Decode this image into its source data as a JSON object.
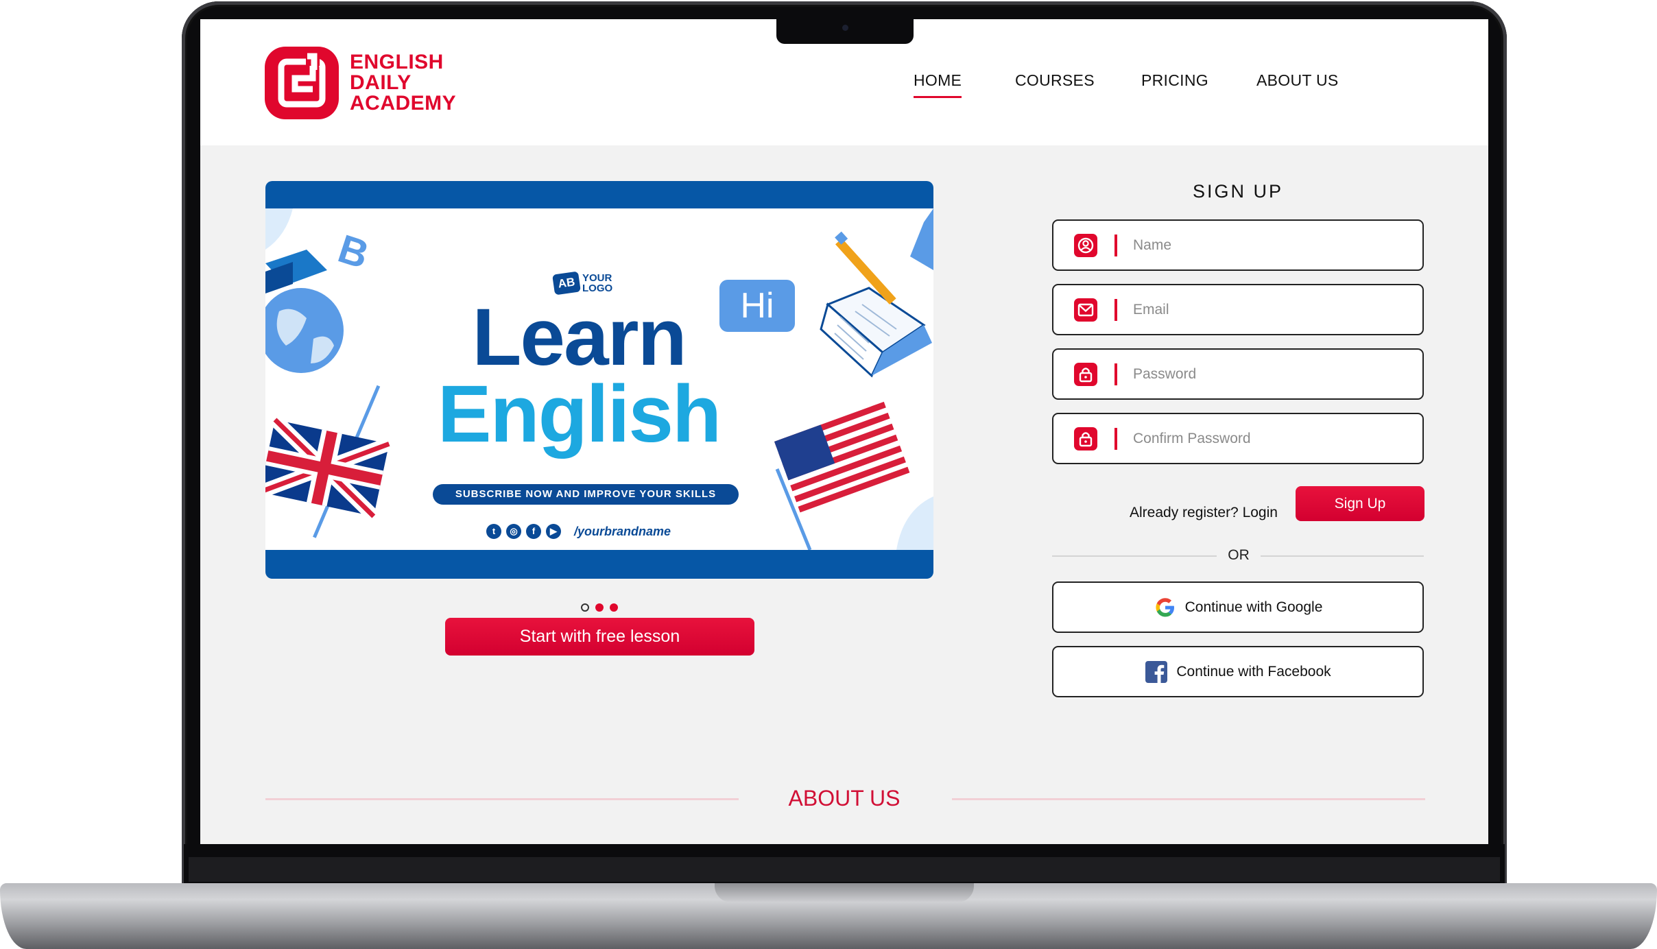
{
  "brand": {
    "logo_icon": "ed-monogram-logo",
    "name_lines": [
      "ENGLISH",
      "DAILY",
      "ACADEMY"
    ],
    "accent_color": "#e0072d"
  },
  "nav": {
    "items": [
      {
        "label": "HOME",
        "active": true
      },
      {
        "label": "COURSES",
        "active": false
      },
      {
        "label": "PRICING",
        "active": false
      },
      {
        "label": "ABOUT US",
        "active": false
      }
    ]
  },
  "banner": {
    "logo_badge": "AB",
    "logo_text": "YOUR LOGO",
    "speech_bubble": "Hi",
    "headline_line1": "Learn",
    "headline_line2": "English",
    "tagline": "SUBSCRIBE NOW AND IMPROVE YOUR SKILLS",
    "social_icons": [
      "twitter-icon",
      "instagram-icon",
      "facebook-icon",
      "youtube-icon"
    ],
    "handle": "/yourbrandname",
    "slide_count": 3,
    "active_slide": 1
  },
  "hero": {
    "cta_label": "Start with free lesson"
  },
  "signup": {
    "title": "SIGN UP",
    "fields": [
      {
        "placeholder": "Name",
        "icon": "user-icon"
      },
      {
        "placeholder": "Email",
        "icon": "mail-icon"
      },
      {
        "placeholder": "Password",
        "icon": "lock-icon"
      },
      {
        "placeholder": "Confirm Password",
        "icon": "lock-icon"
      }
    ],
    "login_prompt": "Already register? Login",
    "submit_label": "Sign Up",
    "divider_text": "OR",
    "google_label": "Continue with Google",
    "facebook_label": "Continue with Facebook"
  },
  "about": {
    "title": "ABOUT US"
  }
}
